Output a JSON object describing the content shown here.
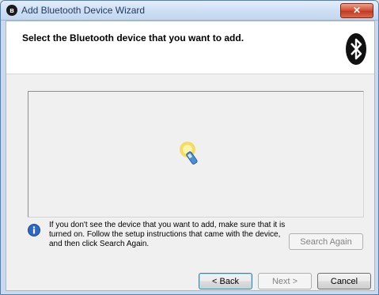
{
  "window": {
    "title": "Add Bluetooth Device Wizard",
    "close_label": "✕"
  },
  "header": {
    "title": "Select the Bluetooth device that you want to add."
  },
  "info": {
    "text": "If you don't see the device that you want to add, make sure that it is turned on. Follow the setup instructions that came with the device, and then click Search Again."
  },
  "buttons": {
    "search_again": "Search Again",
    "back": "< Back",
    "next": "Next >",
    "cancel": "Cancel"
  },
  "colors": {
    "accent": "#1e395b",
    "bluetooth": "#1a1a1a"
  }
}
